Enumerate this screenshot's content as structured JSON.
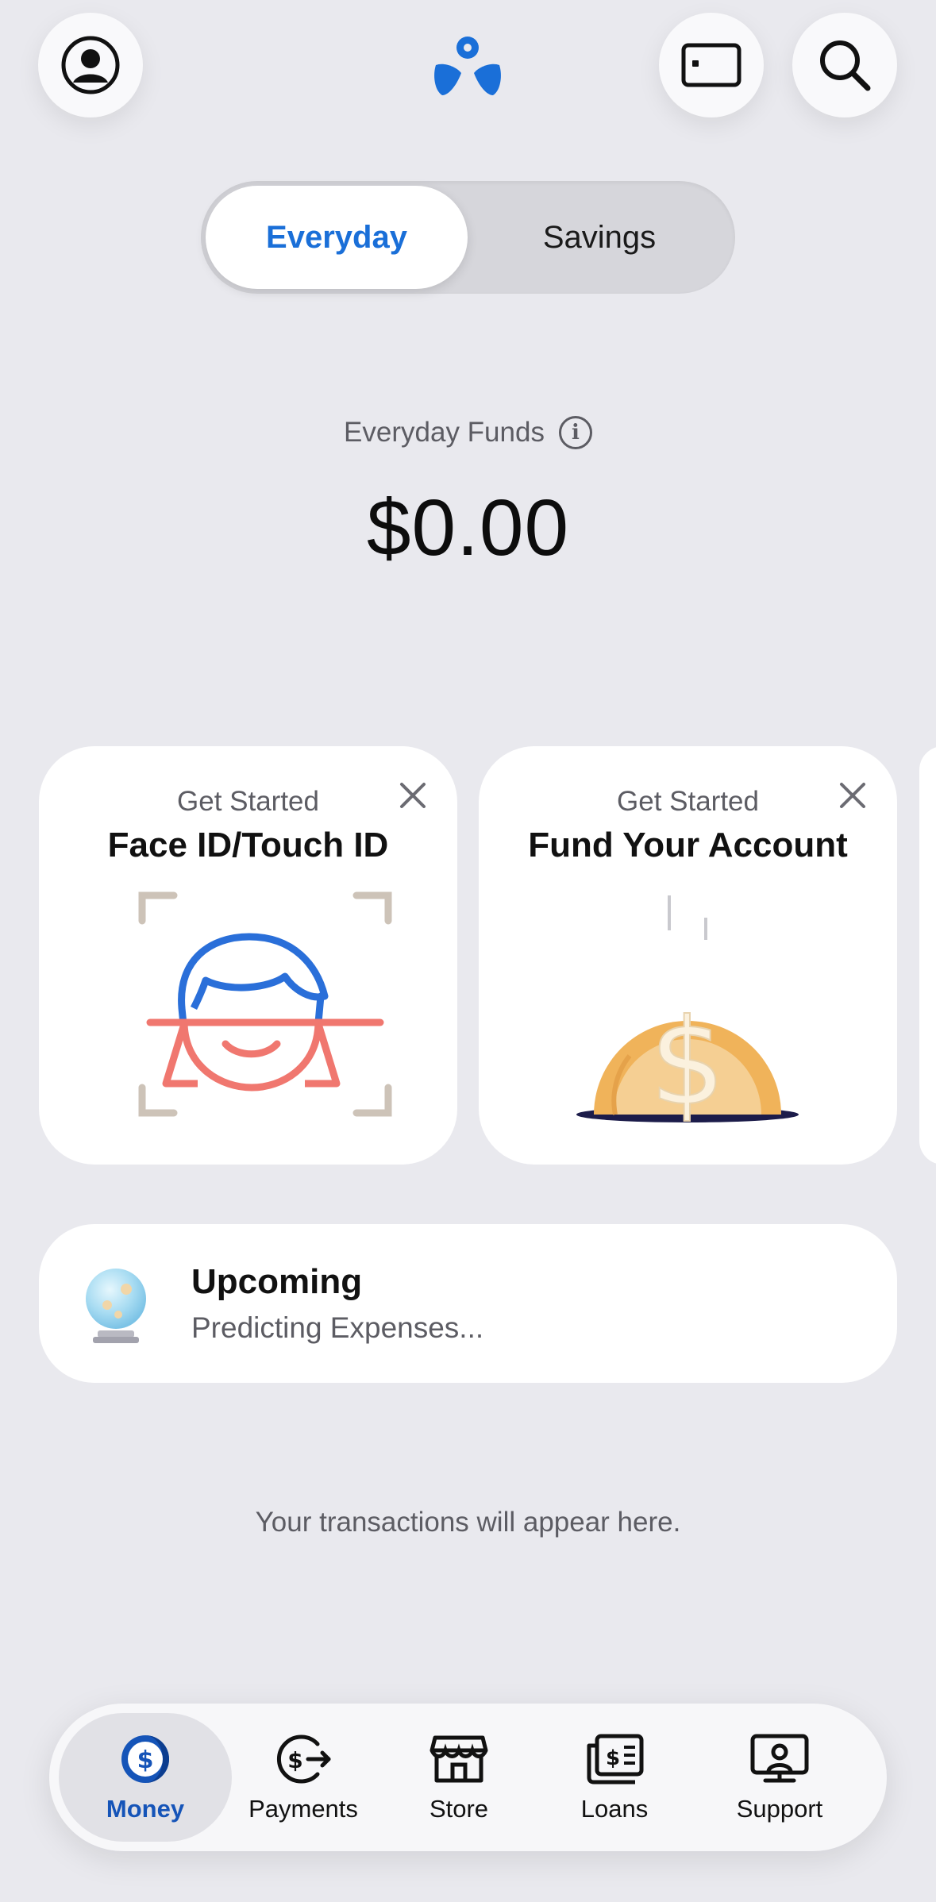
{
  "header": {
    "profile_icon": "person-circle-icon",
    "card_icon": "card-icon",
    "search_icon": "search-icon",
    "logo_icon": "brand-logo-icon"
  },
  "tabs": {
    "items": [
      {
        "label": "Everyday",
        "selected": true
      },
      {
        "label": "Savings",
        "selected": false
      }
    ]
  },
  "funds": {
    "label": "Everyday Funds",
    "amount": "$0.00",
    "info_icon": "info-icon"
  },
  "cards": [
    {
      "subtitle": "Get Started",
      "title": "Face ID/Touch ID",
      "illustration": "face-scan-icon"
    },
    {
      "subtitle": "Get Started",
      "title": "Fund Your Account",
      "illustration": "coin-icon"
    }
  ],
  "upcoming": {
    "title": "Upcoming",
    "subtitle": "Predicting Expenses...",
    "icon": "crystal-ball-icon"
  },
  "empty_state": "Your transactions will appear here.",
  "bottom_nav": {
    "items": [
      {
        "label": "Money",
        "icon": "money-icon",
        "active": true
      },
      {
        "label": "Payments",
        "icon": "payments-icon",
        "active": false
      },
      {
        "label": "Store",
        "icon": "store-icon",
        "active": false
      },
      {
        "label": "Loans",
        "icon": "loans-icon",
        "active": false
      },
      {
        "label": "Support",
        "icon": "support-icon",
        "active": false
      }
    ]
  },
  "colors": {
    "background": "#e9e9ee",
    "accent": "#1a6fd8",
    "nav_active": "#1554b8"
  }
}
